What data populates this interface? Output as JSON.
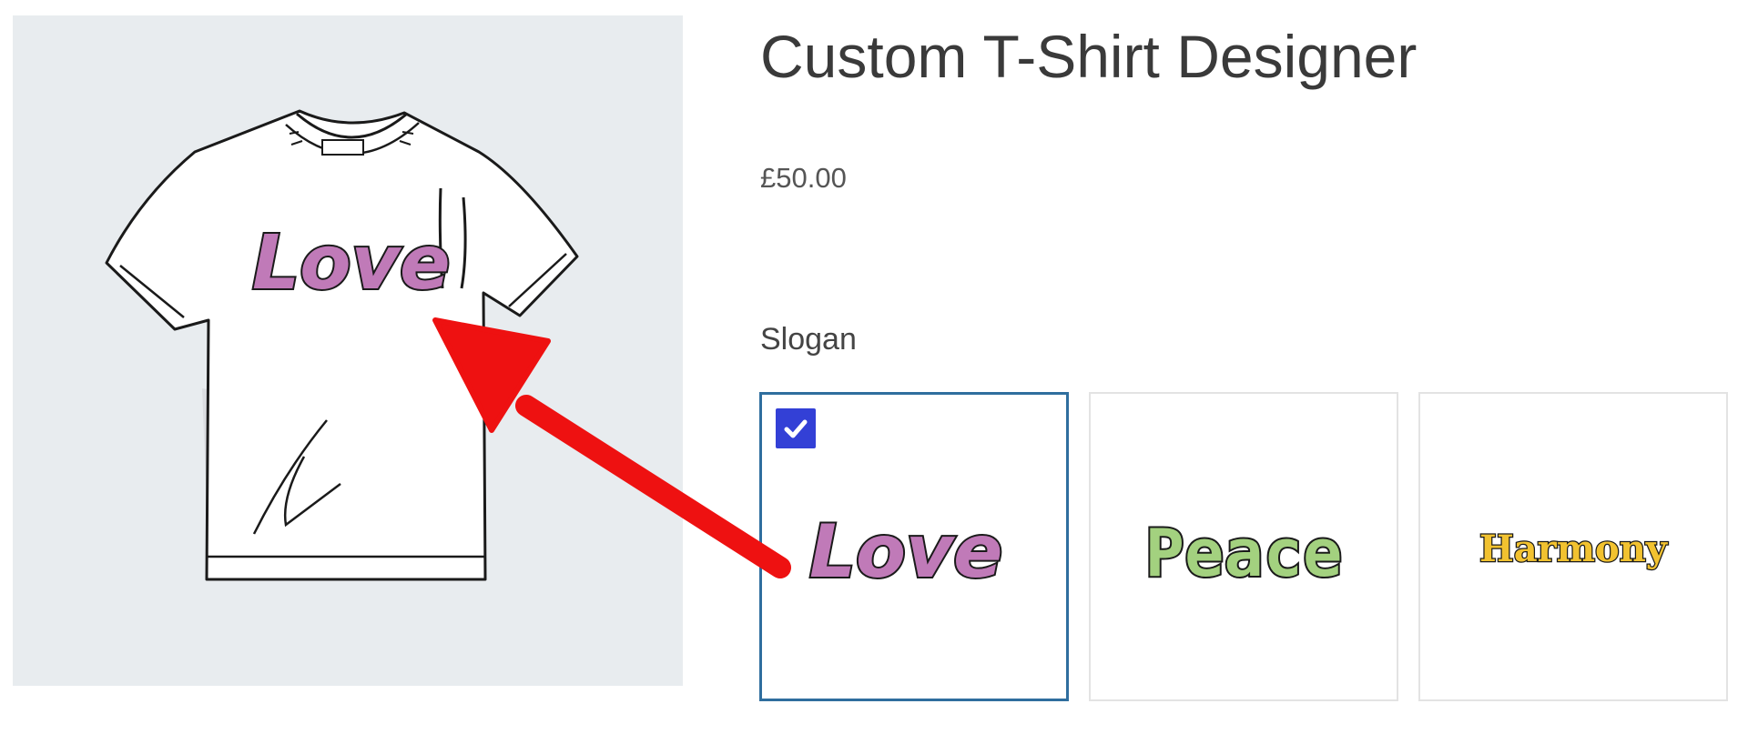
{
  "product": {
    "title": "Custom T-Shirt Designer",
    "price": "£50.00"
  },
  "preview": {
    "slogan_text": "Love",
    "slogan_fill": "#c07ab8"
  },
  "slogan": {
    "label": "Slogan",
    "selected": "Love",
    "options": [
      {
        "name": "Love",
        "fill": "#c07ab8",
        "selected": true
      },
      {
        "name": "Peace",
        "fill": "#a3d17f",
        "selected": false
      },
      {
        "name": "Harmony",
        "fill": "#f2c230",
        "selected": false
      }
    ]
  },
  "icons": {
    "check": "checkmark-icon",
    "arrow": "red-arrow-annotation"
  },
  "colors": {
    "selected_border": "#2f6e9e",
    "check_bg": "#3340d6",
    "arrow": "#ee1111",
    "preview_bg": "#e8ecef"
  }
}
